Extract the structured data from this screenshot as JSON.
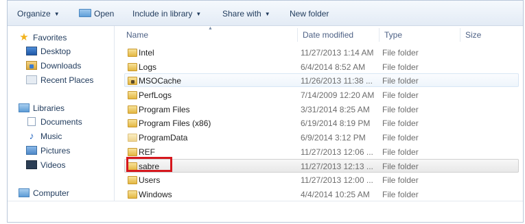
{
  "toolbar": {
    "organize": "Organize",
    "open": "Open",
    "include": "Include in library",
    "share": "Share with",
    "new_folder": "New folder"
  },
  "nav": {
    "favorites": "Favorites",
    "desktop": "Desktop",
    "downloads": "Downloads",
    "recent": "Recent Places",
    "libraries": "Libraries",
    "documents": "Documents",
    "music": "Music",
    "pictures": "Pictures",
    "videos": "Videos",
    "computer": "Computer"
  },
  "columns": {
    "name": "Name",
    "date": "Date modified",
    "type": "Type",
    "size": "Size"
  },
  "files": [
    {
      "name": "Intel",
      "date": "11/27/2013 1:14 AM",
      "type": "File folder"
    },
    {
      "name": "Logs",
      "date": "6/4/2014 8:52 AM",
      "type": "File folder"
    },
    {
      "name": "MSOCache",
      "date": "11/26/2013 11:38 ...",
      "type": "File folder"
    },
    {
      "name": "PerfLogs",
      "date": "7/14/2009 12:20 AM",
      "type": "File folder"
    },
    {
      "name": "Program Files",
      "date": "3/31/2014 8:25 AM",
      "type": "File folder"
    },
    {
      "name": "Program Files (x86)",
      "date": "6/19/2014 8:19 PM",
      "type": "File folder"
    },
    {
      "name": "ProgramData",
      "date": "6/9/2014 3:12 PM",
      "type": "File folder"
    },
    {
      "name": "REF",
      "date": "11/27/2013 12:06 ...",
      "type": "File folder"
    },
    {
      "name": "sabre",
      "date": "11/27/2013 12:13 ...",
      "type": "File folder"
    },
    {
      "name": "Users",
      "date": "11/27/2013 12:00 ...",
      "type": "File folder"
    },
    {
      "name": "Windows",
      "date": "4/4/2014 10:25 AM",
      "type": "File folder"
    }
  ],
  "colors": {
    "highlight_box": "#d6171d",
    "folder": "#e3b742",
    "text": "#1e395b"
  }
}
